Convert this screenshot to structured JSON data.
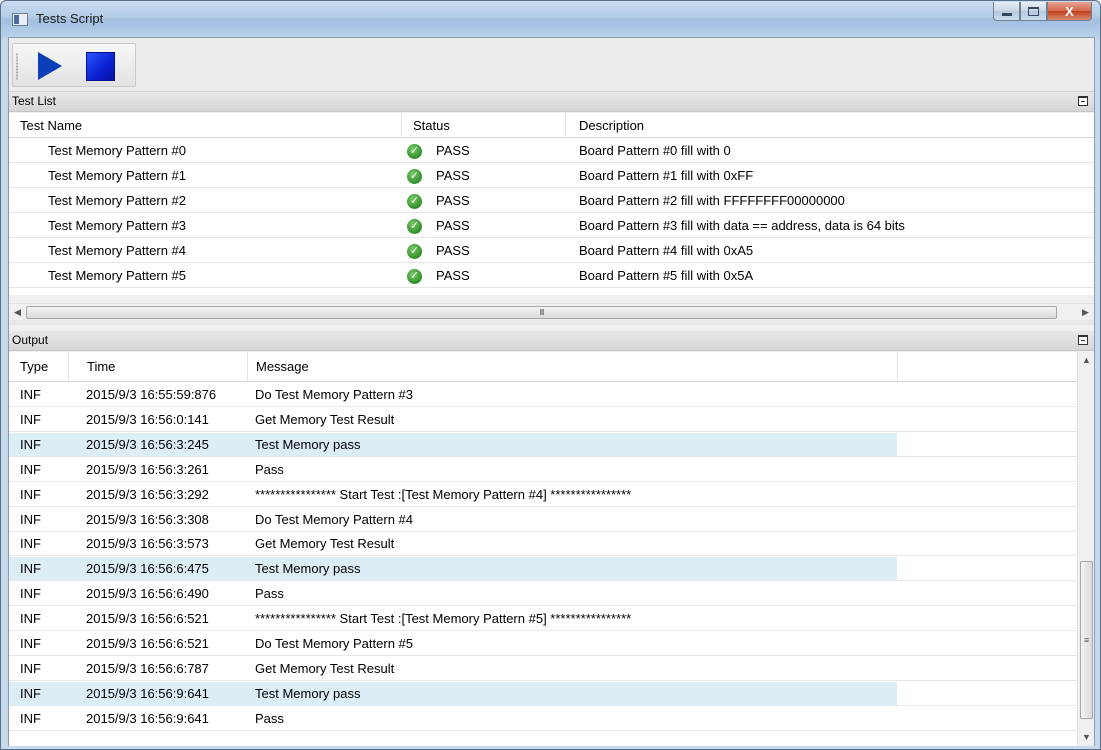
{
  "window": {
    "title": "Tests Script",
    "controls": {
      "minimize": "minimize",
      "maximize": "maximize",
      "close": "X"
    }
  },
  "toolbar": {
    "buttons": [
      {
        "name": "run",
        "icon": "play-icon",
        "color": "#0a3fb8"
      },
      {
        "name": "stop",
        "icon": "stop-icon",
        "color": "#0a1fd0"
      }
    ]
  },
  "test_list": {
    "title": "Test List",
    "columns": [
      "Test Name",
      "Status",
      "Description"
    ],
    "rows": [
      {
        "name": "Test Memory Pattern #0",
        "status": "PASS",
        "description": "Board Pattern #0 fill with 0"
      },
      {
        "name": "Test Memory Pattern #1",
        "status": "PASS",
        "description": "Board Pattern #1 fill with 0xFF"
      },
      {
        "name": "Test Memory Pattern #2",
        "status": "PASS",
        "description": "Board Pattern #2 fill with FFFFFFFF00000000"
      },
      {
        "name": "Test Memory Pattern #3",
        "status": "PASS",
        "description": "Board Pattern #3 fill with data == address, data is 64 bits"
      },
      {
        "name": "Test Memory Pattern #4",
        "status": "PASS",
        "description": "Board Pattern #4 fill with 0xA5"
      },
      {
        "name": "Test Memory Pattern #5",
        "status": "PASS",
        "description": "Board Pattern #5 fill with 0x5A"
      }
    ],
    "scroll_thumb_grip": "III"
  },
  "output": {
    "title": "Output",
    "columns": [
      "Type",
      "Time",
      "Message"
    ],
    "rows": [
      {
        "type": "INF",
        "time": "2015/9/3 16:55:59:876",
        "message": "Do Test Memory Pattern #3",
        "highlight": false
      },
      {
        "type": "INF",
        "time": "2015/9/3 16:56:0:141",
        "message": "Get Memory Test Result",
        "highlight": false
      },
      {
        "type": "INF",
        "time": "2015/9/3 16:56:3:245",
        "message": "Test Memory pass",
        "highlight": true
      },
      {
        "type": "INF",
        "time": "2015/9/3 16:56:3:261",
        "message": "Pass",
        "highlight": false
      },
      {
        "type": "INF",
        "time": "2015/9/3 16:56:3:292",
        "message": "**************** Start Test :[Test Memory Pattern #4] ****************",
        "highlight": false
      },
      {
        "type": "INF",
        "time": "2015/9/3 16:56:3:308",
        "message": "Do Test Memory Pattern #4",
        "highlight": false
      },
      {
        "type": "INF",
        "time": "2015/9/3 16:56:3:573",
        "message": "Get Memory Test Result",
        "highlight": false
      },
      {
        "type": "INF",
        "time": "2015/9/3 16:56:6:475",
        "message": "Test Memory pass",
        "highlight": true
      },
      {
        "type": "INF",
        "time": "2015/9/3 16:56:6:490",
        "message": "Pass",
        "highlight": false
      },
      {
        "type": "INF",
        "time": "2015/9/3 16:56:6:521",
        "message": "**************** Start Test :[Test Memory Pattern #5] ****************",
        "highlight": false
      },
      {
        "type": "INF",
        "time": "2015/9/3 16:56:6:521",
        "message": "Do Test Memory Pattern #5",
        "highlight": false
      },
      {
        "type": "INF",
        "time": "2015/9/3 16:56:6:787",
        "message": "Get Memory Test Result",
        "highlight": false
      },
      {
        "type": "INF",
        "time": "2015/9/3 16:56:9:641",
        "message": "Test Memory pass",
        "highlight": true
      },
      {
        "type": "INF",
        "time": "2015/9/3 16:56:9:641",
        "message": "Pass",
        "highlight": false
      }
    ],
    "scroll_thumb_grip": "≡",
    "highlight_color": "#dcedf5"
  }
}
